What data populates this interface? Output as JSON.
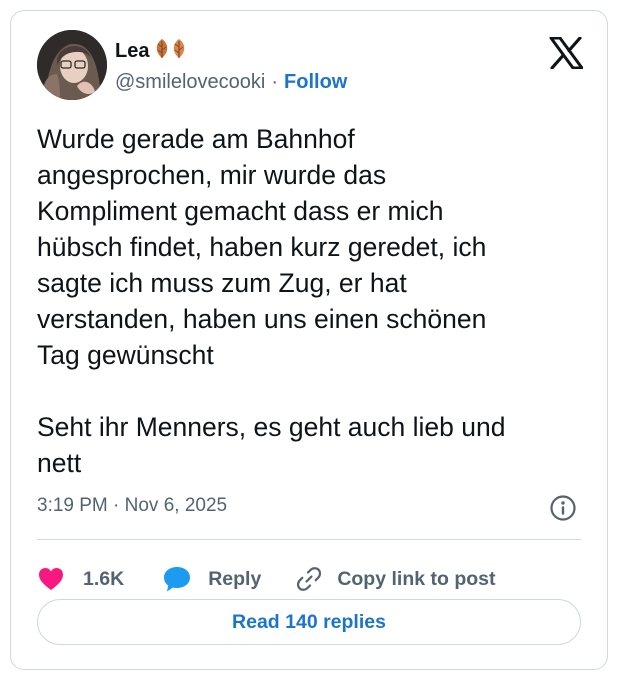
{
  "user": {
    "display_name": "Lea",
    "name_emoji": "leaf-emoji",
    "handle": "@smilelovecooki",
    "separator": "·",
    "follow_label": "Follow"
  },
  "tweet": {
    "text": "Wurde gerade am Bahnhof\nangesprochen, mir wurde das\nKompliment gemacht dass er mich\nhübsch findet, haben kurz geredet, ich\nsagte ich muss zum Zug, er hat\nverstanden, haben uns einen schönen\nTag gewünscht\n\nSeht ihr Menners, es geht auch lieb und\nnett",
    "timestamp": "3:19 PM · Nov 6, 2025"
  },
  "actions": {
    "likes": "1.6K",
    "reply_label": "Reply",
    "copy_label": "Copy link to post"
  },
  "read_replies_label": "Read 140 replies",
  "colors": {
    "like": "#f91880",
    "reply_bubble": "#1d9bf0",
    "link": "#1d75c8",
    "muted": "#536471",
    "border": "#cfd9de"
  }
}
